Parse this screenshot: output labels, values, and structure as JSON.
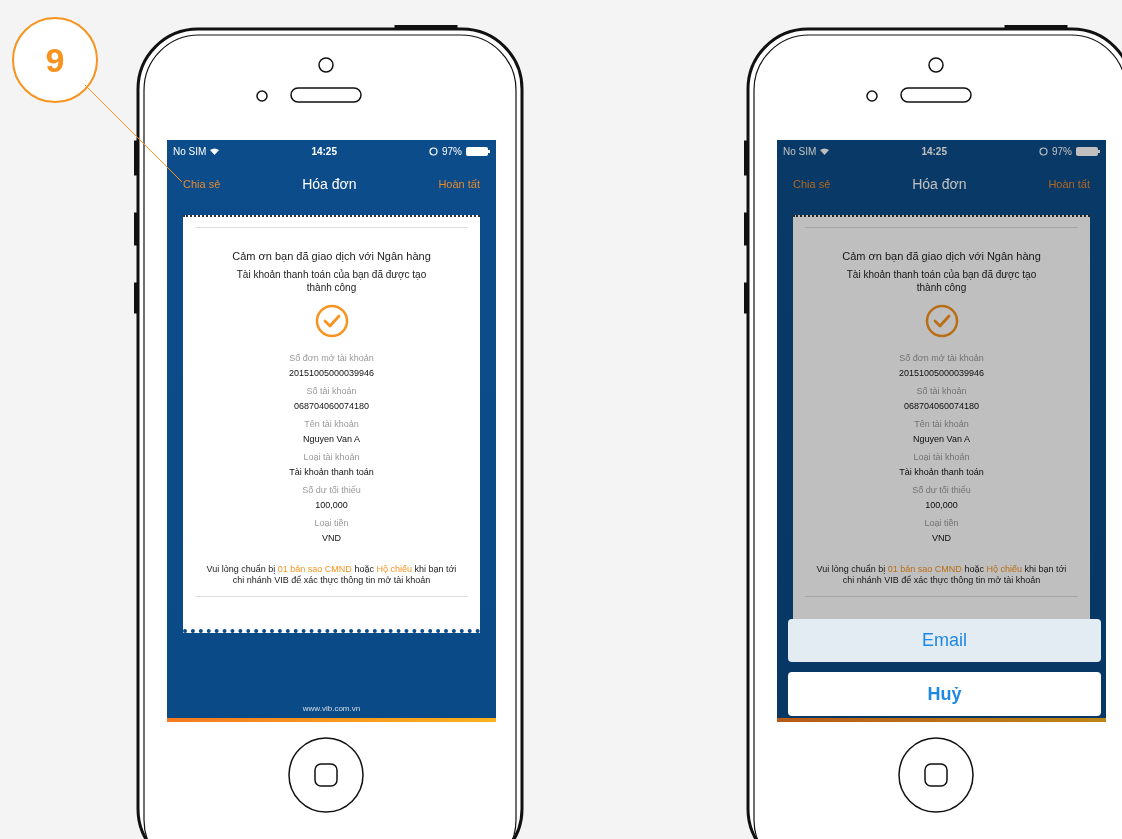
{
  "callout": {
    "label": "9"
  },
  "screens": [
    {
      "dimmed": false,
      "status_bar": {
        "carrier": "No SIM",
        "time": "14:25",
        "battery": "97%"
      },
      "nav": {
        "left": "Chia sẻ",
        "title": "Hóa đơn",
        "right": "Hoàn tất"
      },
      "receipt": {
        "heading": "Cảm ơn bạn đã giao dịch với Ngân hàng",
        "subheading": "Tài khoản thanh toán của bạn đã được tạo thành công",
        "fields": [
          {
            "label": "Số đơn mở tài khoản",
            "value": "20151005000039946"
          },
          {
            "label": "Số tài khoản",
            "value": "068704060074180"
          },
          {
            "label": "Tên tài khoản",
            "value": "Nguyen Van A"
          },
          {
            "label": "Loại tài khoản",
            "value": "Tài khoản thanh toán"
          },
          {
            "label": "Số dư tối thiểu",
            "value": "100,000"
          },
          {
            "label": "Loại tiền",
            "value": "VND"
          }
        ],
        "note": "Vui lòng chuẩn bị **01 bản sao CMND** hoặc **Hộ chiếu** khi bạn tới chi nhánh VIB để xác thực thông tin mở tài khoản"
      },
      "footer": "www.vib.com.vn"
    },
    {
      "dimmed": true,
      "status_bar": {
        "carrier": "No SIM",
        "time": "14:25",
        "battery": "97%"
      },
      "nav": {
        "left": "Chia sẻ",
        "title": "Hóa đơn",
        "right": "Hoàn tất"
      },
      "receipt": {
        "heading": "Cảm ơn bạn đã giao dịch với Ngân hàng",
        "subheading": "Tài khoản thanh toán của bạn đã được tạo thành công",
        "fields": [
          {
            "label": "Số đơn mở tài khoản",
            "value": "20151005000039946"
          },
          {
            "label": "Số tài khoản",
            "value": "068704060074180"
          },
          {
            "label": "Tên tài khoản",
            "value": "Nguyen Van A"
          },
          {
            "label": "Loại tài khoản",
            "value": "Tài khoản thanh toán"
          },
          {
            "label": "Số dư tối thiểu",
            "value": "100,000"
          },
          {
            "label": "Loại tiền",
            "value": "VND"
          }
        ],
        "note": "Vui lòng chuẩn bị **01 bản sao CMND** hoặc **Hộ chiếu** khi bạn tới chi nhánh VIB để xác thực thông tin mở tài khoản"
      },
      "action_sheet": {
        "options": [
          "Email"
        ],
        "cancel": "Huỷ"
      }
    }
  ]
}
